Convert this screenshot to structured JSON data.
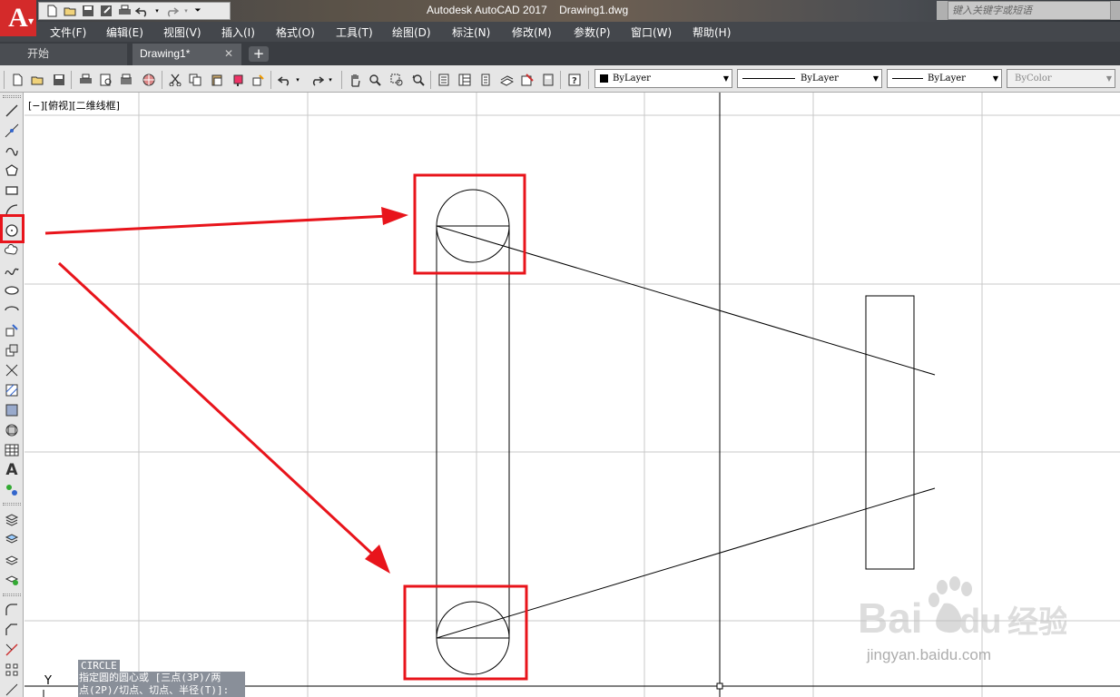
{
  "app": {
    "logo_letter": "A",
    "title_app": "Autodesk AutoCAD 2017",
    "title_file": "Drawing1.dwg",
    "search_placeholder": "键入关键字或短语"
  },
  "menu": [
    {
      "label": "文件(F)"
    },
    {
      "label": "编辑(E)"
    },
    {
      "label": "视图(V)"
    },
    {
      "label": "插入(I)"
    },
    {
      "label": "格式(O)"
    },
    {
      "label": "工具(T)"
    },
    {
      "label": "绘图(D)"
    },
    {
      "label": "标注(N)"
    },
    {
      "label": "修改(M)"
    },
    {
      "label": "参数(P)"
    },
    {
      "label": "窗口(W)"
    },
    {
      "label": "帮助(H)"
    }
  ],
  "tabs": {
    "start": "开始",
    "drawing": "Drawing1*",
    "close_glyph": "✕",
    "new_glyph": "+"
  },
  "properties": {
    "color": "ByLayer",
    "linetype": "ByLayer",
    "lineweight": "ByLayer",
    "plotstyle": "ByColor"
  },
  "viewport": {
    "label": "[−][俯视][二维线框]"
  },
  "command": {
    "name": "CIRCLE",
    "line1": "指定圆的圆心或 [三点(3P)/两",
    "line2": "点(2P)/切点、切点、半径(T)]:"
  },
  "ucs": {
    "y_label": "Y"
  },
  "watermark": {
    "brand": "Baidu经验",
    "url": "jingyan.baidu.com"
  },
  "colors": {
    "highlight": "#e8141b",
    "logo": "#d42a2a",
    "menubar": "#44474c",
    "grid": "#c9c9c9"
  },
  "icons": {
    "circle_tool": "circle-icon"
  }
}
